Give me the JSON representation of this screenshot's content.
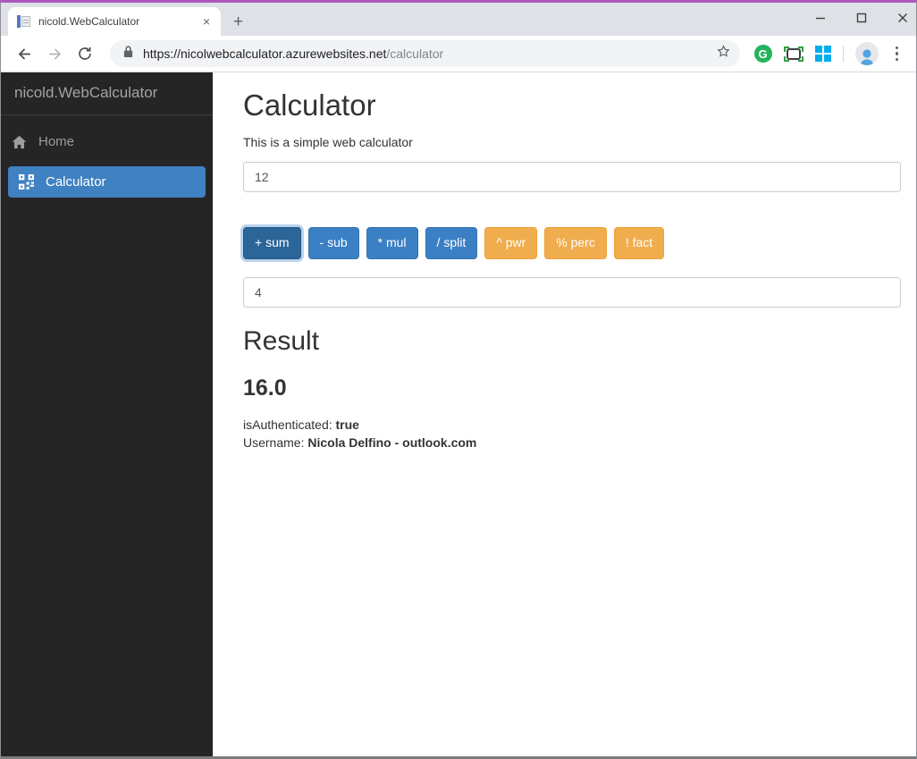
{
  "window": {
    "accent_top_color": "#ae57be",
    "icons": {
      "tab_close": "×",
      "new_tab": "+"
    }
  },
  "browser": {
    "tab": {
      "title": "nicold.WebCalculator"
    },
    "address_bar": {
      "url_host": "https://nicolwebcalculator.azurewebsites.net",
      "url_path": "/calculator"
    },
    "extensions": {
      "grammarly_letter": "G"
    }
  },
  "sidebar": {
    "brand": "nicold.WebCalculator",
    "items": [
      {
        "label": "Home",
        "icon": "home-icon",
        "active": false
      },
      {
        "label": "Calculator",
        "icon": "qr-grid-icon",
        "active": true
      }
    ],
    "active_color": "#3f81c1"
  },
  "calculator": {
    "title": "Calculator",
    "subtitle": "This is a simple web calculator",
    "operand1": "12",
    "operand2": "4",
    "buttons": [
      {
        "id": "sum",
        "label": "+ sum",
        "variant": "primary-active"
      },
      {
        "id": "sub",
        "label": "- sub",
        "variant": "primary"
      },
      {
        "id": "mul",
        "label": "* mul",
        "variant": "primary"
      },
      {
        "id": "split",
        "label": "/ split",
        "variant": "primary"
      },
      {
        "id": "pwr",
        "label": "^ pwr",
        "variant": "warning"
      },
      {
        "id": "perc",
        "label": "% perc",
        "variant": "warning"
      },
      {
        "id": "fact",
        "label": "! fact",
        "variant": "warning"
      }
    ],
    "button_colors": {
      "primary": "#3b80c4",
      "primary_active": "#2c6598",
      "warning": "#f0ad4e"
    },
    "result": {
      "title": "Result",
      "value": "16.0"
    },
    "auth": {
      "label": "isAuthenticated:",
      "value": "true"
    },
    "user": {
      "label": "Username:",
      "value": "Nicola Delfino - outlook.com"
    }
  }
}
